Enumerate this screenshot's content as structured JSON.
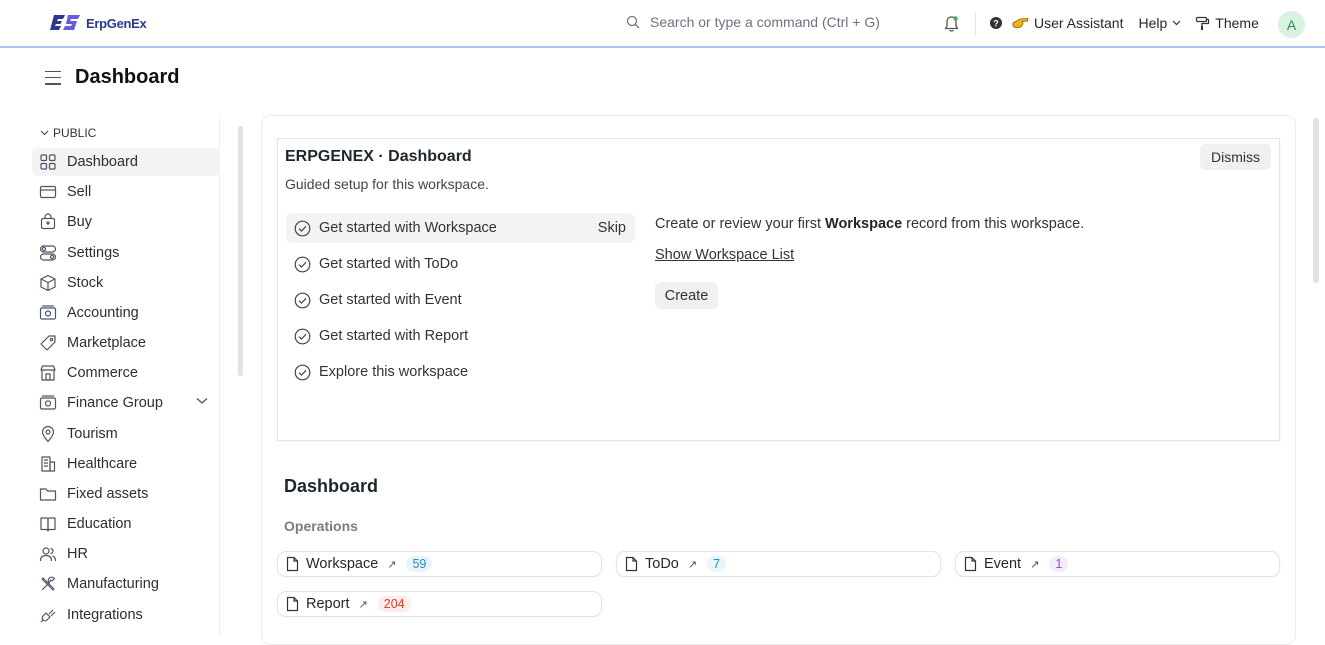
{
  "brand": {
    "name": "ErpGenEx",
    "color": "#2b3a8c"
  },
  "navbar": {
    "search_placeholder": "Search or type a command (Ctrl + G)",
    "user_assistant": "User Assistant",
    "help": "Help",
    "theme": "Theme",
    "avatar_initial": "A"
  },
  "page": {
    "title": "Dashboard"
  },
  "sidebar": {
    "group": "PUBLIC",
    "items": [
      {
        "label": "Dashboard",
        "icon": "grid-icon",
        "active": true
      },
      {
        "label": "Sell",
        "icon": "card-icon"
      },
      {
        "label": "Buy",
        "icon": "bag-icon"
      },
      {
        "label": "Settings",
        "icon": "toggles-icon"
      },
      {
        "label": "Stock",
        "icon": "box-icon"
      },
      {
        "label": "Accounting",
        "icon": "money-icon"
      },
      {
        "label": "Marketplace",
        "icon": "tag-icon"
      },
      {
        "label": "Commerce",
        "icon": "store-icon"
      },
      {
        "label": "Finance Group",
        "icon": "money-icon",
        "has_children": true
      },
      {
        "label": "Tourism",
        "icon": "pin-icon"
      },
      {
        "label": "Healthcare",
        "icon": "building-icon"
      },
      {
        "label": "Fixed assets",
        "icon": "folder-icon"
      },
      {
        "label": "Education",
        "icon": "book-icon"
      },
      {
        "label": "HR",
        "icon": "users-icon"
      },
      {
        "label": "Manufacturing",
        "icon": "tools-icon"
      },
      {
        "label": "Integrations",
        "icon": "plug-icon"
      }
    ]
  },
  "onboarding": {
    "title": "ERPGENEX · Dashboard",
    "subtitle": "Guided setup for this workspace.",
    "dismiss": "Dismiss",
    "skip": "Skip",
    "steps": [
      "Get started with Workspace",
      "Get started with ToDo",
      "Get started with Event",
      "Get started with Report",
      "Explore this workspace"
    ],
    "desc_pre": "Create or review your first ",
    "desc_bold": "Workspace",
    "desc_post": " record from this workspace.",
    "link": "Show Workspace List",
    "create": "Create"
  },
  "dashboard": {
    "title": "Dashboard",
    "section": "Operations",
    "cards": [
      {
        "label": "Workspace",
        "count": "59",
        "color": "#2a8bbf"
      },
      {
        "label": "ToDo",
        "count": "7",
        "color": "#2a8bbf"
      },
      {
        "label": "Event",
        "count": "1",
        "color": "#9a4fc9"
      },
      {
        "label": "Report",
        "count": "204",
        "color": "#d9412b"
      }
    ]
  }
}
